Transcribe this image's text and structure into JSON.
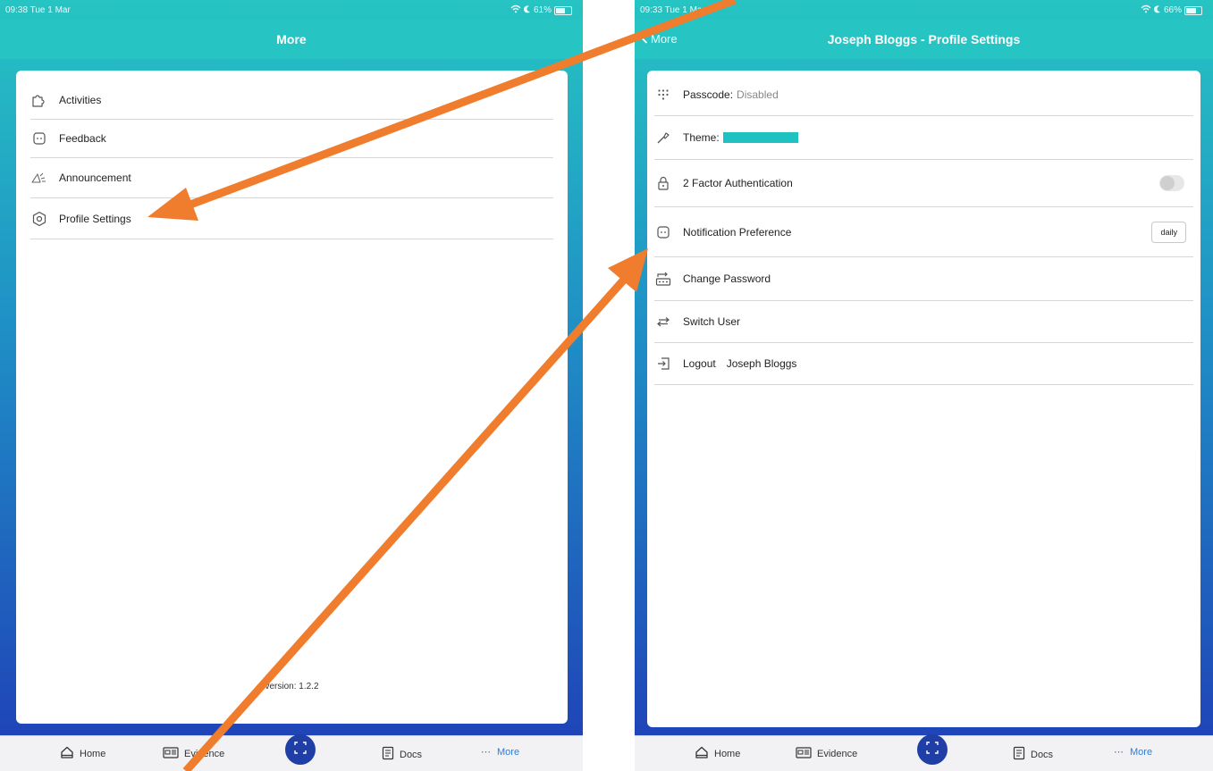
{
  "left": {
    "status": {
      "time": "09:38  Tue 1 Mar",
      "battery": "61%"
    },
    "nav": {
      "title": "More"
    },
    "menu": [
      {
        "label": "Activities",
        "icon": "puzzle-icon"
      },
      {
        "label": "Feedback",
        "icon": "chat-icon"
      },
      {
        "label": "Announcement",
        "icon": "megaphone-icon"
      },
      {
        "label": "Profile Settings",
        "icon": "gear-icon"
      }
    ],
    "version": "version: 1.2.2",
    "tabs": {
      "home": "Home",
      "evidence": "Evidence",
      "docs": "Docs",
      "more": "More"
    }
  },
  "right": {
    "status": {
      "time": "09:33  Tue 1 Mar",
      "battery": "66%"
    },
    "nav": {
      "back": "More",
      "title": "Joseph Bloggs - Profile Settings"
    },
    "rows": {
      "passcode_label": "Passcode:",
      "passcode_value": "Disabled",
      "theme_label": "Theme:",
      "theme_color": "#1fc2c1",
      "two_factor_label": "2 Factor Authentication",
      "two_factor_enabled": false,
      "notification_label": "Notification Preference",
      "notification_value": "daily",
      "change_password_label": "Change Password",
      "switch_user_label": "Switch User",
      "logout_label": "Logout",
      "logout_user": "Joseph Bloggs"
    },
    "tabs": {
      "home": "Home",
      "evidence": "Evidence",
      "docs": "Docs",
      "more": "More"
    }
  },
  "colors": {
    "accent": "#26c4c2",
    "gradient_bottom": "#1f45b8",
    "annotation_arrow": "#f07d2d",
    "active_tab": "#2a7ee0"
  }
}
